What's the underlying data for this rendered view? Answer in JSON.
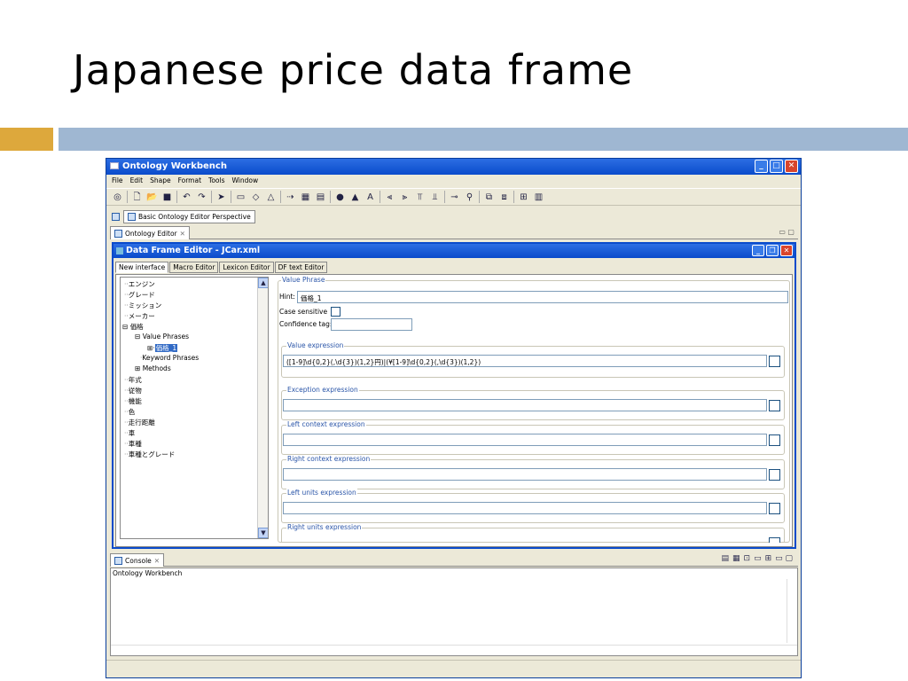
{
  "slide": {
    "title": "Japanese price data frame"
  },
  "window": {
    "title": "Ontology Workbench",
    "menu": [
      "File",
      "Edit",
      "Shape",
      "Format",
      "Tools",
      "Window"
    ]
  },
  "perspective": {
    "label": "Basic Ontology Editor Perspective"
  },
  "editor_tab": {
    "label": "Ontology Editor",
    "close": "✕"
  },
  "inner": {
    "title": "Data Frame Editor - JCar.xml",
    "tabs": [
      "New interface",
      "Macro Editor",
      "Lexicon Editor",
      "DF text Editor"
    ]
  },
  "tree": {
    "items": [
      "エンジン",
      "グレード",
      "ミッション",
      "メーカー",
      "価格",
      "Value Phrases",
      "価格_1",
      "Keyword Phrases",
      "Methods",
      "年式",
      "従物",
      "機能",
      "色",
      "走行距離",
      "車",
      "車種",
      "車種とグレード"
    ]
  },
  "form": {
    "value_phrase_label": "Value Phrase",
    "hint_label": "Hint:",
    "hint_value": "価格_1",
    "case_sensitive_label": "Case sensitive",
    "confidence_label": "Confidence tag:",
    "confidence_value": "",
    "value_expression_label": "Value expression",
    "value_expression": "([1-9]\\d{0,2}(,\\d{3})(1,2}円)|(¥[1-9]\\d{0,2}(,\\d{3})(1,2})",
    "exception_label": "Exception expression",
    "left_context_label": "Left context expression",
    "right_context_label": "Right context expression",
    "left_units_label": "Left units expression",
    "right_units_label": "Right units expression"
  },
  "console": {
    "tab_label": "Console",
    "close": "✕",
    "content": "Ontology Workbench"
  }
}
